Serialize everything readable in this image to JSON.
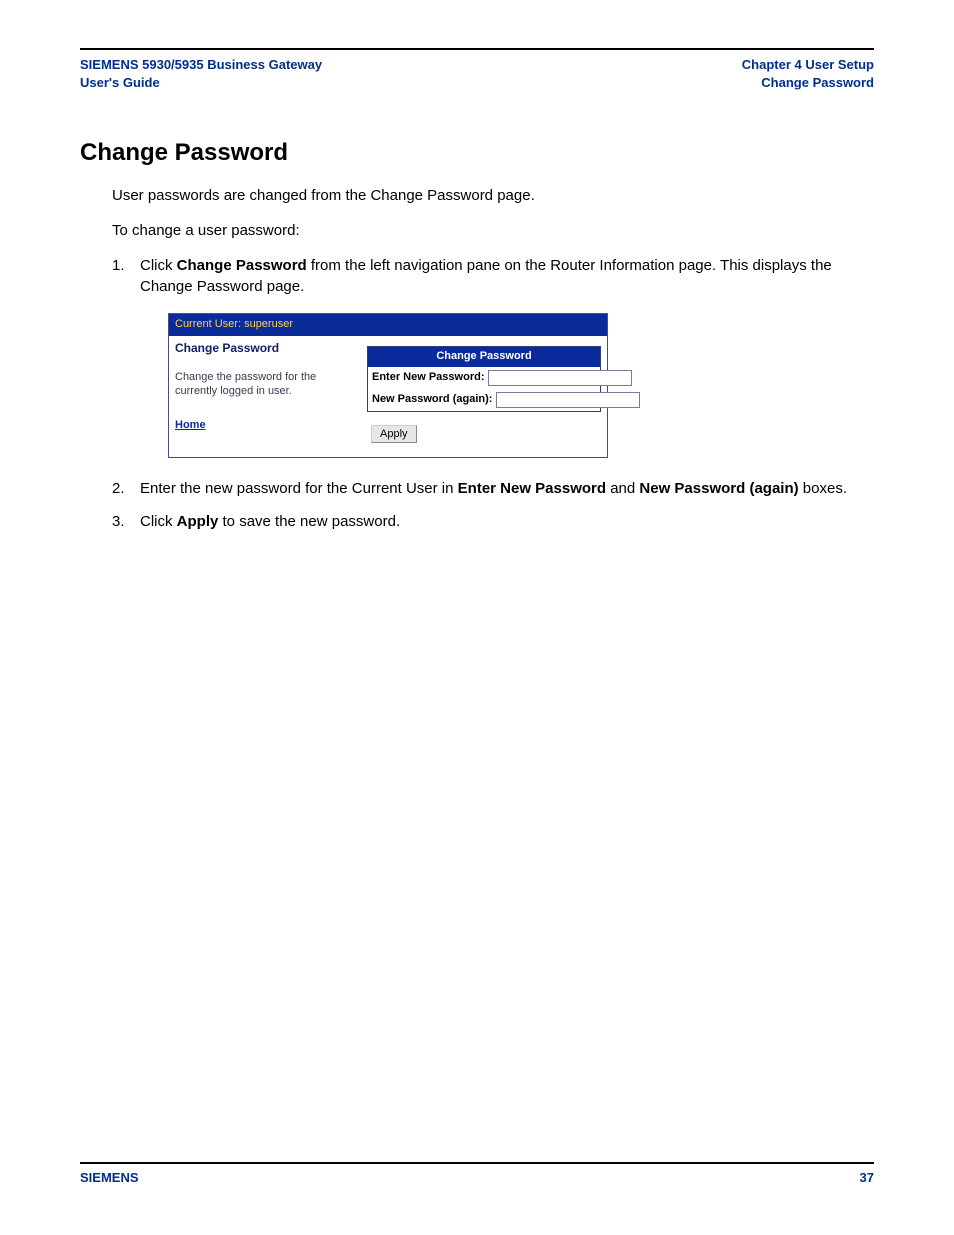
{
  "header": {
    "left_line1": "SIEMENS 5930/5935 Business Gateway",
    "left_line2": "User's Guide",
    "right_line1": "Chapter 4  User Setup",
    "right_line2": "Change Password"
  },
  "section": {
    "heading": "Change Password",
    "para1": "User passwords are changed from the Change Password page.",
    "para2": "To change a user password:"
  },
  "steps": {
    "s1_pre": "Click ",
    "s1_bold": "Change Password",
    "s1_post": " from the left navigation pane on the Router Information page. This displays the Change Password page.",
    "s2_pre": "Enter the new password for the Current User in ",
    "s2_b1": "Enter New Password",
    "s2_mid": " and ",
    "s2_b2": "New Password (again)",
    "s2_post": " boxes.",
    "s3_pre": "Click ",
    "s3_bold": "Apply",
    "s3_post": " to save the new password."
  },
  "screenshot": {
    "topbar": "Current User: superuser",
    "left_title": "Change Password",
    "left_desc": "Change the password for the currently logged in user.",
    "home_link": "Home",
    "form_header": "Change Password",
    "label_new": "Enter New Password:",
    "label_again": "New Password (again):",
    "apply_label": "Apply"
  },
  "footer": {
    "brand": "SIEMENS",
    "page_number": "37"
  }
}
